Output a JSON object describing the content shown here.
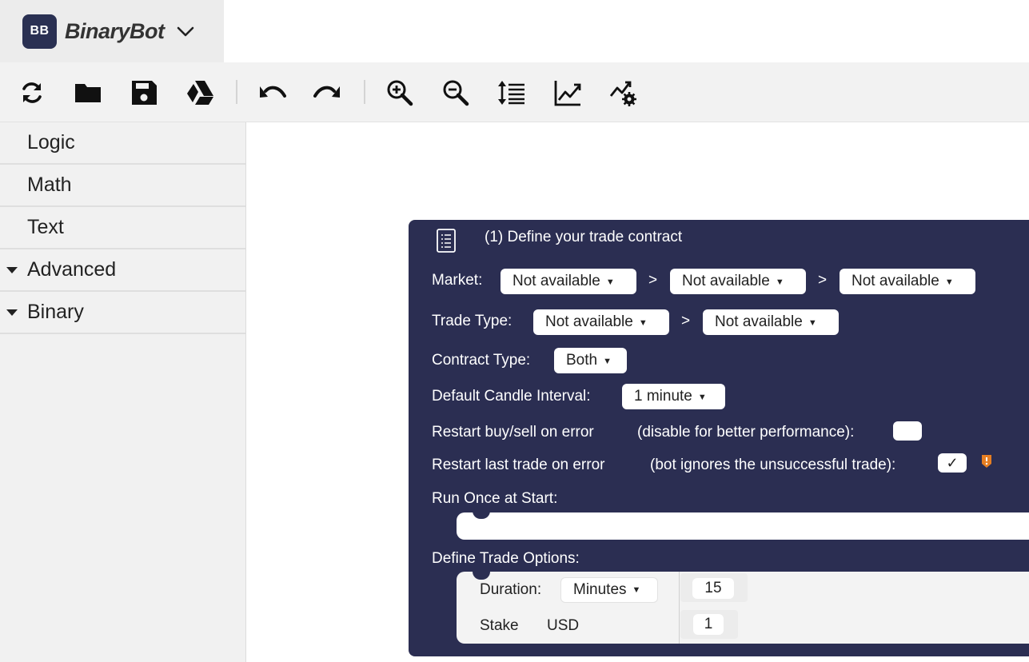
{
  "brand": {
    "logo_text": "BB",
    "name": "BinaryBot"
  },
  "toolbar": {
    "buttons": [
      {
        "name": "reset",
        "icon": "refresh-icon"
      },
      {
        "name": "open",
        "icon": "folder-icon"
      },
      {
        "name": "save",
        "icon": "save-icon"
      },
      {
        "name": "google-drive",
        "icon": "google-drive-icon"
      },
      {
        "name": "undo",
        "icon": "undo-icon"
      },
      {
        "name": "redo",
        "icon": "redo-icon"
      },
      {
        "name": "zoom-in",
        "icon": "zoom-in-icon"
      },
      {
        "name": "zoom-out",
        "icon": "zoom-out-icon"
      },
      {
        "name": "rearrange",
        "icon": "sort-lines-icon"
      },
      {
        "name": "chart",
        "icon": "chart-icon"
      },
      {
        "name": "trading-view",
        "icon": "chart-settings-icon"
      }
    ]
  },
  "sidebar": {
    "categories": [
      {
        "label": "Logic",
        "expandable": false
      },
      {
        "label": "Math",
        "expandable": false
      },
      {
        "label": "Text",
        "expandable": false
      },
      {
        "label": "Advanced",
        "expandable": true
      },
      {
        "label": "Binary",
        "expandable": true
      }
    ]
  },
  "block": {
    "title": "(1) Define your trade contract",
    "market": {
      "label": "Market:",
      "values": [
        "Not available",
        "Not available",
        "Not available"
      ],
      "separator": ">"
    },
    "trade_type": {
      "label": "Trade Type:",
      "values": [
        "Not available",
        "Not available"
      ],
      "separator": ">"
    },
    "contract_type": {
      "label": "Contract Type:",
      "value": "Both"
    },
    "candle_interval": {
      "label": "Default Candle Interval:",
      "value": "1 minute"
    },
    "restart_buy_sell": {
      "label": "Restart buy/sell on error",
      "hint": "(disable for better performance):",
      "checked": false
    },
    "restart_last_trade": {
      "label": "Restart last trade on error",
      "hint": "(bot ignores the unsuccessful trade):",
      "checked": true,
      "check_mark": "✓"
    },
    "run_once": {
      "label": "Run Once at Start:"
    },
    "trade_options": {
      "label": "Define Trade Options:",
      "duration": {
        "label": "Duration:",
        "unit": "Minutes",
        "value": "15"
      },
      "stake": {
        "label": "Stake",
        "currency": "USD",
        "value": "1"
      }
    }
  },
  "colors": {
    "block_bg": "#2b2e52",
    "brand_logo_bg": "#2a3052",
    "warning": "#e67e22",
    "sidebar_bg": "#f1f1f1",
    "toolbar_bg": "#f2f2f2"
  }
}
